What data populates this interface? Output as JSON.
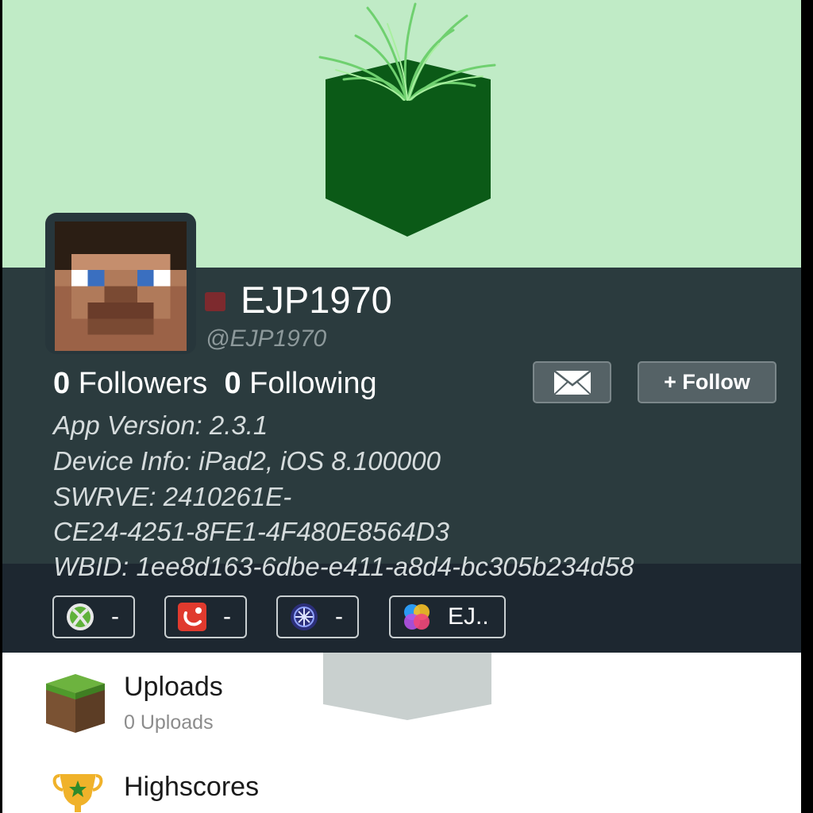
{
  "profile": {
    "username": "EJP1970",
    "handle": "@EJP1970",
    "followers_count": "0",
    "followers_label": "Followers",
    "following_count": "0",
    "following_label": "Following",
    "status_color": "#7d2a2e"
  },
  "actions": {
    "mail_icon": "envelope-icon",
    "follow_label": "+ Follow"
  },
  "info_lines": [
    "App Version: 2.3.1",
    "Device Info: iPad2, iOS 8.100000",
    "SWRVE: 2410261E-",
    "CE24-4251-8FE1-4F480E8564D3",
    "WBID: 1ee8d163-6dbe-e411-a8d4-bc305b234d58"
  ],
  "accounts": [
    {
      "icon": "xbox-icon",
      "value": "-"
    },
    {
      "icon": "swrve-icon",
      "value": "-"
    },
    {
      "icon": "playstation-icon",
      "value": "-"
    },
    {
      "icon": "game-center-icon",
      "value": "EJ.."
    }
  ],
  "menu": [
    {
      "icon": "grass-block-icon",
      "title": "Uploads",
      "subtitle": "0 Uploads"
    },
    {
      "icon": "trophy-icon",
      "title": "Highscores",
      "subtitle": ""
    }
  ],
  "colors": {
    "banner": "#c0ebc6",
    "panel": "#2b3b3e",
    "accounts_bar": "#1d2730",
    "block_green": "#0b5a17"
  }
}
